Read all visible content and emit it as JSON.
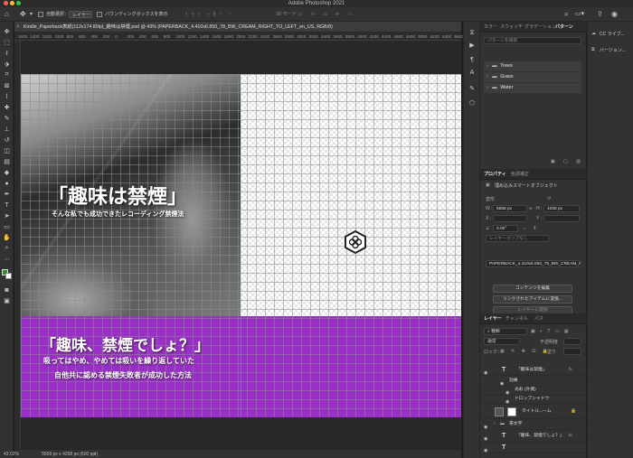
{
  "app": {
    "title": "Adobe Photoshop 2021"
  },
  "options_bar": {
    "auto_select_label": "自動選択：",
    "auto_select_target": "レイヤー",
    "bounding_box_label": "バウンディングボックスを表示",
    "mode_3d_label": "3D モード："
  },
  "document": {
    "tab_label": "Kindle_Paperback表紙(112x174 80lp)_趣味は禁煙.psd @ 43% (PAPERBACK_4.410x6.850_78_BW_CREAM_RIGHT_TO_LEFT_en_US, RGB/8)",
    "ruler_ticks": [
      "1600",
      "1400",
      "1200",
      "1000",
      "800",
      "600",
      "400",
      "200",
      "0",
      "200",
      "400",
      "600",
      "800",
      "1000",
      "1200",
      "1400",
      "1600",
      "1800",
      "2000",
      "2200",
      "2400",
      "2600",
      "2800",
      "3000",
      "3200",
      "3400",
      "3600",
      "3800",
      "4000",
      "4200",
      "4400",
      "4600",
      "4800",
      "5000",
      "5200",
      "5400",
      "5600"
    ]
  },
  "canvas": {
    "cover_title": "「趣味は禁煙」",
    "cover_subtitle": "そんな私でも成功できたレコーディング禁煙法",
    "back_title": "「趣味、禁煙でしょ？」",
    "back_line1": "吸ってはやめ、やめては吸いを繰り返していた",
    "back_line2": "自他共に認める禁煙失敗者が成功した方法",
    "purple_color": "#9a2fc7"
  },
  "status_bar": {
    "zoom": "43.02%",
    "doc_info": "5558 px x 4258 px (600 ppi)"
  },
  "panels": {
    "top_tabs": [
      "カラー",
      "スウォッチ",
      "グラデーション",
      "パターン"
    ],
    "patterns_search_placeholder": "パターンを検索",
    "pattern_folders": [
      "Trees",
      "Grass",
      "Water"
    ],
    "properties_tabs": [
      "プロパティ",
      "色調補正"
    ],
    "properties_type": "埋め込みスマートオブジェクト",
    "transform_label": "変形",
    "w_label": "W :",
    "w_value": "5558 px",
    "h_label": "H :",
    "h_value": "4258 px",
    "x_label": "X :",
    "y_label": "Y :",
    "angle_value": "0.00°",
    "layer_comp_placeholder": "レイヤーカンプなし",
    "smart_object_name": "PAPERBACK_4.410x6.850_78_BW_CREAM_RI...",
    "btn_edit_contents": "コンテンツを編集",
    "btn_convert_linked": "リンクされたアイテムに変換...",
    "btn_convert_layers": "レイヤーに変換",
    "layers_tabs": [
      "レイヤー",
      "チャンネル",
      "パス"
    ],
    "layers_kind": "種類",
    "mode_label": "通常",
    "opacity_label": "不透明度",
    "fill_label": "塗り",
    "lock_label": "ロック：",
    "layers": [
      {
        "name": "「趣味は禁煙」",
        "kind": "text"
      },
      {
        "name": "効果",
        "kind": "effects"
      },
      {
        "name": "光彩 (外側)",
        "kind": "effect"
      },
      {
        "name": "ドロップシャドウ",
        "kind": "effect"
      },
      {
        "name": "タイトル...ーム",
        "kind": "smart"
      },
      {
        "name": "帯文字",
        "kind": "group"
      },
      {
        "name": "「趣味、禁煙でしょ？」",
        "kind": "text"
      }
    ]
  },
  "right_column": {
    "cc_libraries": "CC ライブ...",
    "versions": "バージョン..."
  }
}
